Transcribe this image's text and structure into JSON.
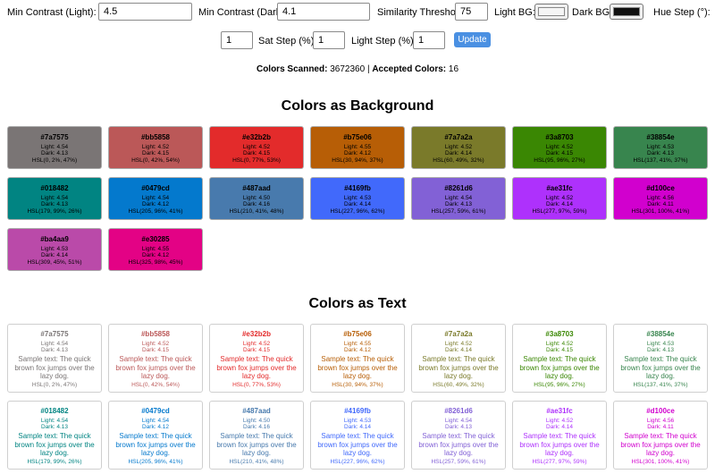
{
  "controls": {
    "min_contrast_light_label": "Min Contrast (Light):",
    "min_contrast_light_value": "4.5",
    "min_contrast_dark_label": "Min Contrast (Dark):",
    "min_contrast_dark_value": "4.1",
    "similarity_label": "Similarity Threshold:",
    "similarity_value": "75",
    "light_bg_label": "Light BG:",
    "light_bg_color": "#f5f5f5",
    "dark_bg_label": "Dark BG:",
    "dark_bg_color": "#111111",
    "hue_step_label": "Hue Step (°):",
    "hue_step_value": "1",
    "sat_step_label": "Sat Step (%):",
    "sat_step_value": "1",
    "light_step_label": "Light Step (%):",
    "light_step_value": "1",
    "update_label": "Update"
  },
  "stats": {
    "scanned_label": "Colors Scanned:",
    "scanned_value": "3672360",
    "separator": "|",
    "accepted_label": "Accepted Colors:",
    "accepted_value": "16"
  },
  "bg_section_title": "Colors as Background",
  "text_section_title": "Colors as Text",
  "sample_text": "Sample text: The quick brown fox jumps over the lazy dog.",
  "colors": [
    {
      "hex": "#7a7575",
      "light": "Light: 4.54",
      "dark": "Dark: 4.13",
      "hsl": "HSL(0, 2%, 47%)"
    },
    {
      "hex": "#bb5858",
      "light": "Light: 4.52",
      "dark": "Dark: 4.15",
      "hsl": "HSL(0, 42%, 54%)"
    },
    {
      "hex": "#e32b2b",
      "light": "Light: 4.52",
      "dark": "Dark: 4.15",
      "hsl": "HSL(0, 77%, 53%)"
    },
    {
      "hex": "#b75e06",
      "light": "Light: 4.55",
      "dark": "Dark: 4.12",
      "hsl": "HSL(30, 94%, 37%)"
    },
    {
      "hex": "#7a7a2a",
      "light": "Light: 4.52",
      "dark": "Dark: 4.14",
      "hsl": "HSL(60, 49%, 32%)"
    },
    {
      "hex": "#3a8703",
      "light": "Light: 4.52",
      "dark": "Dark: 4.15",
      "hsl": "HSL(95, 96%, 27%)"
    },
    {
      "hex": "#38854e",
      "light": "Light: 4.53",
      "dark": "Dark: 4.13",
      "hsl": "HSL(137, 41%, 37%)"
    },
    {
      "hex": "#018482",
      "light": "Light: 4.54",
      "dark": "Dark: 4.13",
      "hsl": "HSL(179, 99%, 26%)"
    },
    {
      "hex": "#0479cd",
      "light": "Light: 4.54",
      "dark": "Dark: 4.12",
      "hsl": "HSL(205, 96%, 41%)"
    },
    {
      "hex": "#487aad",
      "light": "Light: 4.50",
      "dark": "Dark: 4.16",
      "hsl": "HSL(210, 41%, 48%)"
    },
    {
      "hex": "#4169fb",
      "light": "Light: 4.53",
      "dark": "Dark: 4.14",
      "hsl": "HSL(227, 96%, 62%)"
    },
    {
      "hex": "#8261d6",
      "light": "Light: 4.54",
      "dark": "Dark: 4.13",
      "hsl": "HSL(257, 59%, 61%)"
    },
    {
      "hex": "#ae31fc",
      "light": "Light: 4.52",
      "dark": "Dark: 4.14",
      "hsl": "HSL(277, 97%, 59%)"
    },
    {
      "hex": "#d100ce",
      "light": "Light: 4.56",
      "dark": "Dark: 4.11",
      "hsl": "HSL(301, 100%, 41%)"
    },
    {
      "hex": "#ba4aa9",
      "light": "Light: 4.53",
      "dark": "Dark: 4.14",
      "hsl": "HSL(309, 45%, 51%)"
    },
    {
      "hex": "#e30285",
      "light": "Light: 4.55",
      "dark": "Dark: 4.12",
      "hsl": "HSL(325, 98%, 45%)"
    }
  ],
  "text_cards_visible": 14
}
